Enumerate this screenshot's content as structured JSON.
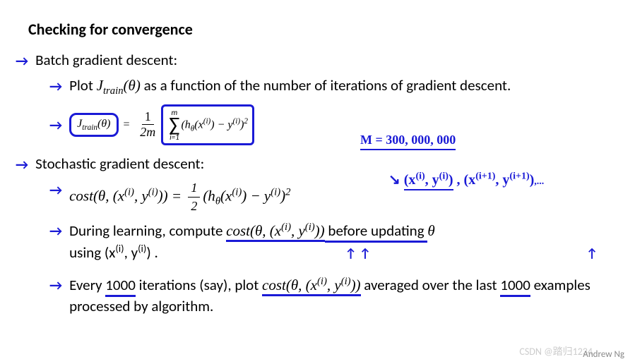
{
  "title": "Checking for convergence",
  "section1": {
    "heading": "Batch gradient descent:",
    "bullet1a": "Plot ",
    "bullet1_jtrain": "J",
    "bullet1_train": "train",
    "bullet1_theta": "(θ)",
    "bullet1b": " as a function of the number of iterations of gradient descent.",
    "formula": {
      "j_label": "J",
      "j_sub": "train",
      "j_arg": "(θ)",
      "eq": " = ",
      "frac_num": "1",
      "frac_den": "2m",
      "sigma_top": "m",
      "sigma_bot": "i=1",
      "body": "(h",
      "body_theta": "θ",
      "body_x": "(x",
      "sup_i": "(i)",
      "body_close": ") − y",
      "sup_i2": "(i)",
      "body_sq": ")",
      "sq": "2"
    }
  },
  "annotations": {
    "m_value": "M = 300, 000, 000",
    "xy_arrow": "↘",
    "xy_pair1": "(x(i), y(i))",
    "xy_comma": " , ",
    "xy_pair2": "(x(i+1), y(i+1))",
    "xy_dots": ",..."
  },
  "section2": {
    "heading": "Stochastic gradient descent:",
    "cost_label": "cost",
    "cost_args": "(θ, (x",
    "cost_sup": "(i)",
    "cost_y": ", y",
    "cost_close": "))",
    "eq": " = ",
    "frac_num": "1",
    "frac_den": "2",
    "body": "(h",
    "body_theta": "θ",
    "body_x": "(x",
    "body_close": ") − y",
    "body_sq": ")",
    "sq": "2",
    "learn1": "During learning, compute ",
    "learn_cost": "cost(θ, (x",
    "learn_cost2": ", y",
    "learn_cost3": "))",
    "learn2": " before updating ",
    "learn_theta": "θ",
    "learn3": "using (x",
    "learn4": ", y",
    "learn5": ") ."
  },
  "cost_arrows": "↑   ↑",
  "theta_arrow": "↑",
  "section3": {
    "text1": "Every ",
    "num1": "1000",
    "text2": " iterations (say), plot ",
    "cost": "cost(θ, (x",
    "cost2": ", y",
    "cost3": "))",
    "text3": " averaged over the last ",
    "num2": "1000",
    "text4": " examples processed by algorithm."
  },
  "watermark": "CSDN @踏归1234",
  "author": "Andrew Ng"
}
